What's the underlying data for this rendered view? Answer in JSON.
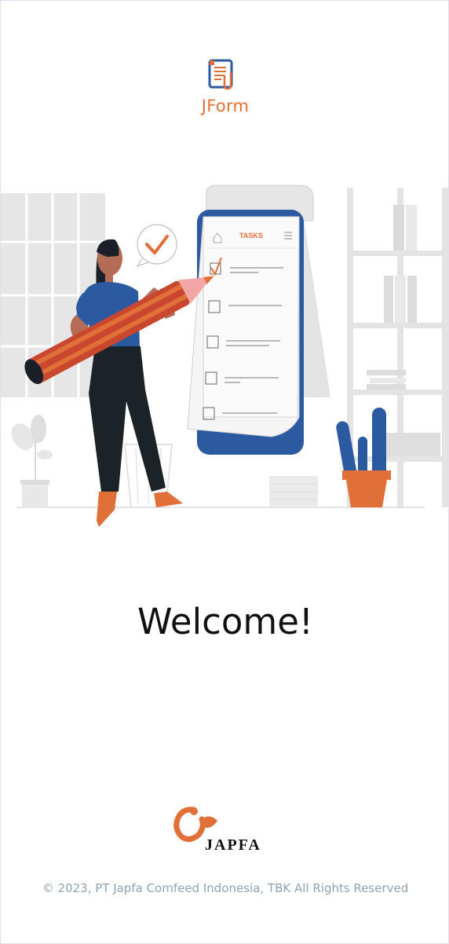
{
  "app": {
    "name": "JForm",
    "logo_icon": "document-paperclip-icon"
  },
  "illustration": {
    "icon": "task-checklist-illustration",
    "phone_title": "TASKS",
    "task_count": 5,
    "checked_count": 1
  },
  "welcome": {
    "title": "Welcome!"
  },
  "footer": {
    "company_logo_text": "JAPFA",
    "copyright": "© 2023, PT Japfa Comfeed Indonesia, TBK All Rights Reserved"
  },
  "colors": {
    "accent_orange": "#e07038",
    "blue": "#2c5aa0",
    "muted_text": "#8fa2b6",
    "background": "#ffffff"
  }
}
